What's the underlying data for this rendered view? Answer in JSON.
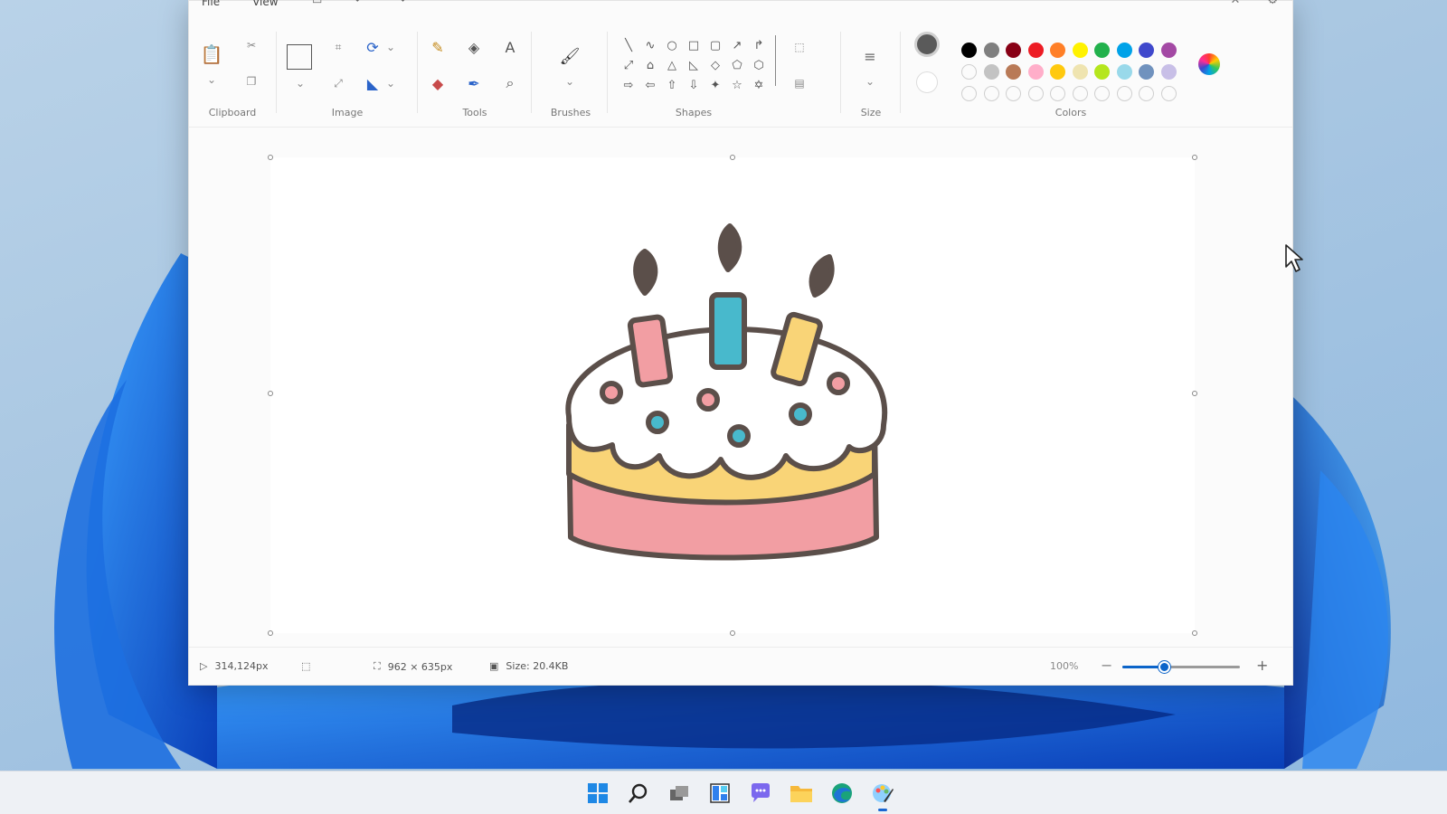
{
  "menubar": {
    "items": [
      "File",
      "View"
    ]
  },
  "ribbon": {
    "groups": {
      "clipboard": "Clipboard",
      "image": "Image",
      "tools": "Tools",
      "brushes": "Brushes",
      "shapes": "Shapes",
      "size": "Size",
      "colors": "Colors"
    },
    "current_colors": {
      "primary": "#5a5a5a",
      "secondary": "#ffffff"
    },
    "palette_row1": [
      "#000000",
      "#7f7f7f",
      "#880015",
      "#ed1c24",
      "#ff7f27",
      "#fff200",
      "#22b14c",
      "#00a2e8",
      "#3f48cc",
      "#a349a4"
    ],
    "palette_row2": [
      "empty",
      "#c3c3c3",
      "#b97a57",
      "#ffaec9",
      "#ffc90e",
      "#efe4b0",
      "#b5e61d",
      "#99d9ea",
      "#7092be",
      "#c8bfe7"
    ]
  },
  "status": {
    "cursor_position": "314,124px",
    "canvas_size": "962 × 635px",
    "file_size": "Size: 20.4KB",
    "zoom": "100%",
    "zoom_fraction": 0.35
  },
  "taskbar": {
    "icons": [
      "start-icon",
      "search-icon",
      "task-view-icon",
      "widgets-icon",
      "chat-icon",
      "file-explorer-icon",
      "edge-icon",
      "paint-icon"
    ]
  },
  "colors": {
    "accent": "#0b64c9"
  }
}
